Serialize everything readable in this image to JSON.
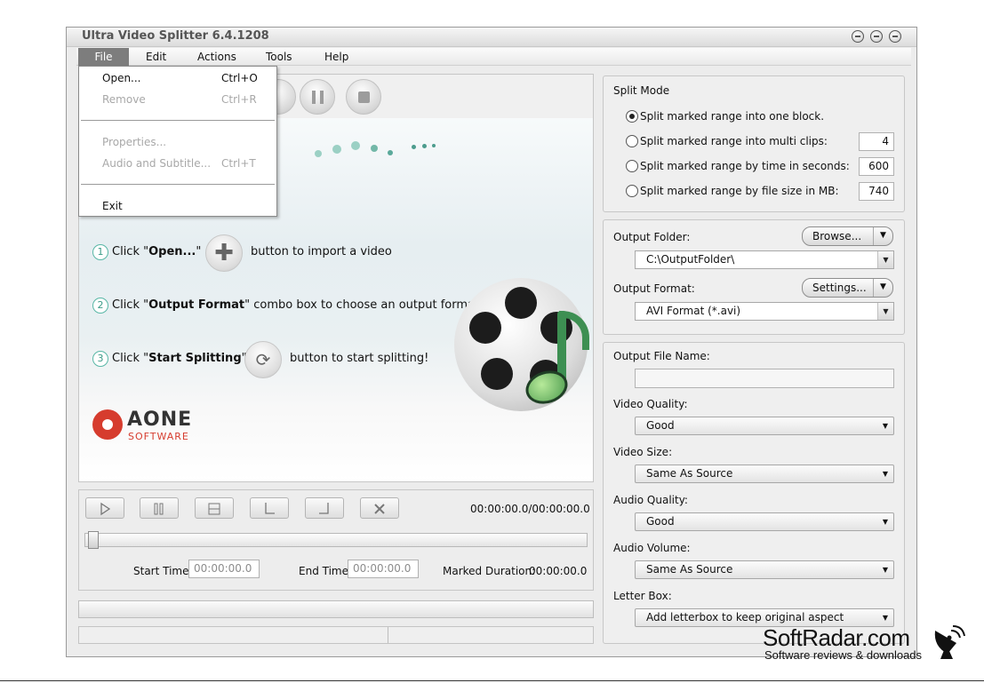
{
  "window": {
    "title": "Ultra Video Splitter 6.4.1208"
  },
  "menubar": {
    "items": [
      "File",
      "Edit",
      "Actions",
      "Tools",
      "Help"
    ]
  },
  "file_menu": {
    "items": [
      {
        "label": "Open...",
        "shortcut": "Ctrl+O",
        "enabled": true
      },
      {
        "label": "Remove",
        "shortcut": "Ctrl+R",
        "enabled": false
      },
      {
        "label": "Properties...",
        "shortcut": "",
        "enabled": false
      },
      {
        "label": "Audio and Subtitle...",
        "shortcut": "Ctrl+T",
        "enabled": false
      },
      {
        "label": "Exit",
        "shortcut": "",
        "enabled": true
      }
    ]
  },
  "steps": [
    {
      "num": "1",
      "pre": "Click \"",
      "bold": "Open...",
      "post": "\"",
      "after": "button to import a video"
    },
    {
      "num": "2",
      "pre": "Click \"",
      "bold": "Output Format",
      "post": "\" combo box to choose an output format",
      "after": ""
    },
    {
      "num": "3",
      "pre": "Click \"",
      "bold": "Start Splitting",
      "post": "\"",
      "after": "button to start splitting!"
    }
  ],
  "logo": {
    "main": "AONE",
    "sub": "SOFTWARE"
  },
  "player": {
    "time_readout": "00:00:00.0/00:00:00.0",
    "start_time_label": "Start Time:",
    "start_time_value": "00:00:00.0",
    "end_time_label": "End Time:",
    "end_time_value": "00:00:00.0",
    "marked_duration_label": "Marked Duration:",
    "marked_duration_value": "00:00:00.0"
  },
  "split_mode": {
    "title": "Split Mode",
    "options": [
      {
        "label": "Split  marked range into one block.",
        "checked": true,
        "value": ""
      },
      {
        "label": "Split marked range into multi clips:",
        "checked": false,
        "value": "4"
      },
      {
        "label": "Split marked range by time in seconds:",
        "checked": false,
        "value": "600"
      },
      {
        "label": "Split marked range by file size in MB:",
        "checked": false,
        "value": "740"
      }
    ]
  },
  "output": {
    "folder_label": "Output Folder:",
    "browse_label": "Browse...",
    "folder_value": "C:\\OutputFolder\\",
    "format_label": "Output Format:",
    "settings_label": "Settings...",
    "format_value": "AVI Format (*.avi)"
  },
  "options": {
    "file_name_label": "Output File Name:",
    "video_quality_label": "Video Quality:",
    "video_quality_value": "Good",
    "video_size_label": "Video Size:",
    "video_size_value": "Same As Source",
    "audio_quality_label": "Audio Quality:",
    "audio_quality_value": "Good",
    "audio_volume_label": "Audio Volume:",
    "audio_volume_value": "Same As Source",
    "letter_box_label": "Letter Box:",
    "letter_box_value": "Add letterbox to keep original aspect"
  },
  "watermark": {
    "main": "SoftRadar.com",
    "sub": "Software reviews & downloads"
  },
  "colors": {
    "accent_red": "#d63c2e",
    "step_teal": "#3a9a87",
    "menu_active": "#7d7d7d"
  }
}
